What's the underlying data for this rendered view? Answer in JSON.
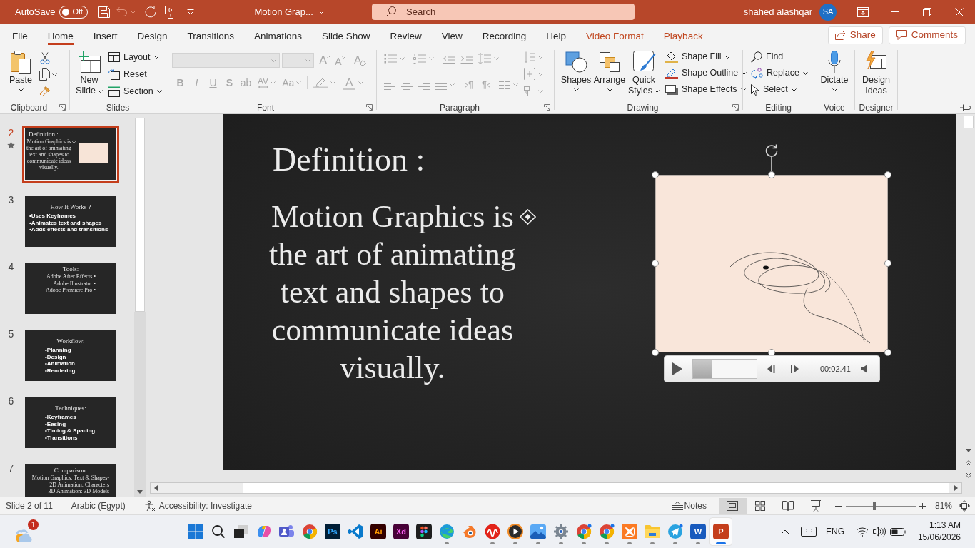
{
  "title_bar": {
    "autosave_label": "AutoSave",
    "autosave": {
      "on": false,
      "label": "Off"
    },
    "undo": {
      "disabled": true
    },
    "document_title": "Motion Grap...",
    "search": {
      "placeholder": "Search"
    },
    "user_name": "shahed alashqar",
    "user_initials": "SA"
  },
  "tabs": [
    {
      "label": "File",
      "selected": false,
      "contextual": false
    },
    {
      "label": "Home",
      "selected": true,
      "contextual": false
    },
    {
      "label": "Insert",
      "selected": false,
      "contextual": false
    },
    {
      "label": "Design",
      "selected": false,
      "contextual": false
    },
    {
      "label": "Transitions",
      "selected": false,
      "contextual": false
    },
    {
      "label": "Animations",
      "selected": false,
      "contextual": false
    },
    {
      "label": "Slide Show",
      "selected": false,
      "contextual": false
    },
    {
      "label": "Review",
      "selected": false,
      "contextual": false
    },
    {
      "label": "View",
      "selected": false,
      "contextual": false
    },
    {
      "label": "Recording",
      "selected": false,
      "contextual": false
    },
    {
      "label": "Help",
      "selected": false,
      "contextual": false
    },
    {
      "label": "Video Format",
      "selected": false,
      "contextual": true
    },
    {
      "label": "Playback",
      "selected": false,
      "contextual": true
    }
  ],
  "share_button": "Share",
  "comments_button": "Comments",
  "ribbon": {
    "clipboard": {
      "label": "Clipboard",
      "paste": "Paste"
    },
    "slides": {
      "label": "Slides",
      "new_slide": [
        "New",
        "Slide"
      ],
      "layout": "Layout",
      "reset": "Reset",
      "section": "Section"
    },
    "font": {
      "label": "Font",
      "disabled": true,
      "grow": "A",
      "shrink": "A",
      "clear": "A",
      "styles": [
        {
          "glyph": "B",
          "kind": "bold"
        },
        {
          "glyph": "I",
          "kind": "italic"
        },
        {
          "glyph": "U",
          "kind": "underline"
        },
        {
          "glyph": "S",
          "kind": "shadow"
        },
        {
          "glyph": "ab",
          "kind": "strikethrough"
        }
      ],
      "spacing": "AV",
      "change_case": "Aa",
      "font_color": "A"
    },
    "paragraph": {
      "label": "Paragraph",
      "disabled": true,
      "ltr": "¶",
      "rtl": "¶"
    },
    "drawing": {
      "label": "Drawing",
      "shapes": "Shapes",
      "arrange": "Arrange",
      "quick_styles": [
        "Quick",
        "Styles"
      ],
      "shape_fill": "Shape Fill",
      "shape_outline": "Shape Outline",
      "shape_effects": "Shape Effects"
    },
    "editing": {
      "label": "Editing",
      "find": "Find",
      "replace": "Replace",
      "select": "Select"
    },
    "voice": {
      "label": "Voice",
      "dictate": "Dictate"
    },
    "designer": {
      "label": "Designer",
      "design_ideas": [
        "Design",
        "Ideas"
      ]
    }
  },
  "slide_panel": {
    "slides": [
      {
        "number": "2",
        "selected": true,
        "animated": true,
        "kind": "definition",
        "title": "Definition :",
        "lines": [
          "Motion Graphics is",
          "the art of animating",
          "text and shapes to",
          "communicate ideas",
          "visually."
        ]
      },
      {
        "number": "3",
        "selected": false,
        "animated": false,
        "kind": "bullets",
        "indented": false,
        "title": "How It Works ?",
        "lines": [
          "•Uses Keyframes",
          "•Animates text and shapes",
          "•Adds effects and transitions"
        ]
      },
      {
        "number": "4",
        "selected": false,
        "animated": false,
        "kind": "list",
        "title": "Tools:",
        "lines": [
          "Adobe After Effects •",
          "Adobe Illustrator •",
          "Adobe Premiere Pro •"
        ]
      },
      {
        "number": "5",
        "selected": false,
        "animated": false,
        "kind": "bullets",
        "indented": true,
        "title": "Workflow:",
        "lines": [
          "•Planning",
          "•Design",
          "•Animation",
          "•Rendering"
        ]
      },
      {
        "number": "6",
        "selected": false,
        "animated": false,
        "kind": "bullets",
        "indented": true,
        "title": "Techniques:",
        "lines": [
          "•Keyframes",
          "•Easing",
          "•Timing & Spacing",
          "•Transitions"
        ]
      },
      {
        "number": "7",
        "selected": false,
        "animated": false,
        "kind": "list",
        "title": "Comparison:",
        "lines": [
          "Motion Graphics: Text & Shapes•",
          "2D Animation: Characters",
          "3D Animation: 3D Models"
        ]
      }
    ]
  },
  "slide": {
    "title": "Definition :",
    "body_lines": [
      "Motion Graphics is",
      "the art of animating",
      "text and shapes to",
      "communicate ideas",
      "visually."
    ],
    "video": {
      "time": "00:02.41",
      "level": 0.29
    }
  },
  "status_bar": {
    "slide_indicator": "Slide 2 of 11",
    "language": "Arabic (Egypt)",
    "accessibility": "Accessibility: Investigate",
    "notes": "Notes",
    "views": [
      {
        "selected": true
      },
      {
        "selected": false
      },
      {
        "selected": false
      },
      {
        "selected": false
      }
    ],
    "zoom": {
      "level": 0.4,
      "reading": "81%"
    }
  },
  "taskbar": {
    "weather_badge": "1",
    "apps": [
      {
        "running": false,
        "selected": false
      },
      {
        "running": false,
        "selected": false
      },
      {
        "running": false,
        "selected": false
      },
      {
        "running": false,
        "selected": false
      },
      {
        "running": false,
        "selected": false
      },
      {
        "running": false,
        "selected": false
      },
      {
        "label": "Ps",
        "running": false,
        "selected": false
      },
      {
        "running": false,
        "selected": false
      },
      {
        "label": "Ai",
        "running": false,
        "selected": false
      },
      {
        "label": "Xd",
        "running": false,
        "selected": false
      },
      {
        "running": false,
        "selected": false
      },
      {
        "running": true,
        "selected": false
      },
      {
        "running": false,
        "selected": false
      },
      {
        "running": true,
        "selected": false
      },
      {
        "running": true,
        "selected": false
      },
      {
        "running": true,
        "selected": false
      },
      {
        "running": true,
        "selected": false
      },
      {
        "running": true,
        "selected": false
      },
      {
        "running": true,
        "selected": false
      },
      {
        "running": true,
        "selected": false
      },
      {
        "running": true,
        "selected": false
      },
      {
        "running": true,
        "selected": false
      },
      {
        "label": "W",
        "running": true,
        "selected": false
      },
      {
        "label": "P",
        "running": true,
        "selected": true
      }
    ],
    "language": "ENG",
    "time": "1:13 AM",
    "date": "15/06/2026"
  }
}
